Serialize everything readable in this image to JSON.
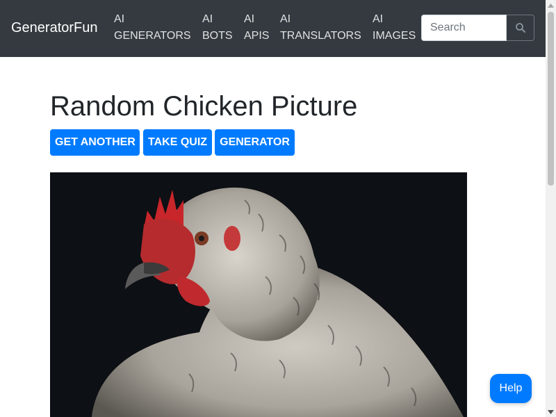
{
  "navbar": {
    "brand": "GeneratorFun",
    "links": [
      {
        "line1": "AI",
        "line2": "GENERATORS"
      },
      {
        "line1": "AI",
        "line2": "BOTS"
      },
      {
        "line1": "AI",
        "line2": "APIS"
      },
      {
        "line1": "AI",
        "line2": "TRANSLATORS"
      },
      {
        "line1": "AI",
        "line2": "IMAGES"
      }
    ],
    "search": {
      "placeholder": "Search",
      "icon": "search-icon"
    }
  },
  "main": {
    "title": "Random Chicken Picture",
    "buttons": {
      "get_another": "GET ANOTHER",
      "take_quiz": "TAKE QUIZ",
      "generator": "GENERATOR"
    },
    "image": {
      "subject": "chicken photo"
    }
  },
  "help_button": "Help",
  "colors": {
    "navbar_bg": "#343a40",
    "primary": "#007bff",
    "text": "#212529",
    "photo_bg": "#0d1014"
  }
}
